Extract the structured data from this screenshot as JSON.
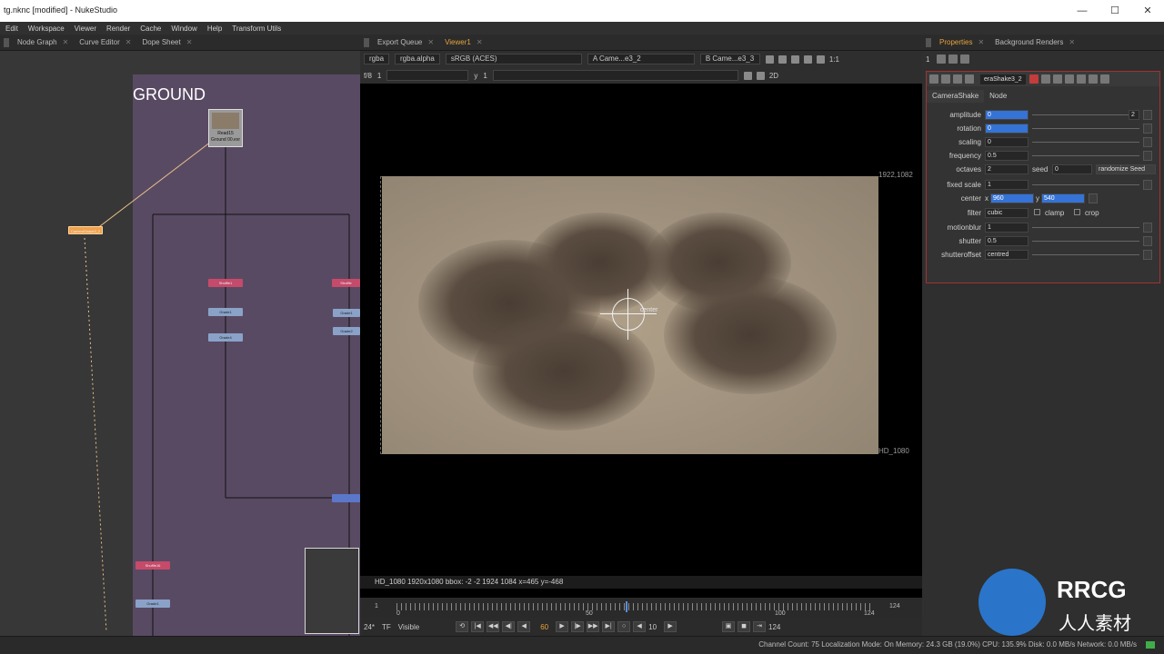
{
  "window": {
    "title": "tg.nknc [modified] - NukeStudio",
    "controls": [
      "—",
      "☐",
      "✕"
    ]
  },
  "menu": [
    "Edit",
    "Workspace",
    "Viewer",
    "Render",
    "Cache",
    "Window",
    "Help",
    "Transform Utils"
  ],
  "left_panel": {
    "tabs": [
      {
        "label": "Node Graph",
        "active": false
      },
      {
        "label": "Curve Editor",
        "active": false
      },
      {
        "label": "Dope Sheet",
        "active": false
      }
    ],
    "backdrop_label": "GROUND",
    "read_node": {
      "line1": "Read15",
      "line2": "Ground 00.exr"
    },
    "nodes": {
      "shuffle_a": "Shuffle1",
      "shuffle_b": "Shuffle",
      "shuffle_c": "Shuffle16",
      "grade_a": "Grade1",
      "grade_b": "Grade4",
      "grade_c": "Grade1",
      "grade_d": "Grade2",
      "grade_e": "Grade1",
      "camshake": "CameraShake3_2"
    }
  },
  "viewer": {
    "tabs": [
      {
        "label": "Export Queue",
        "active": false
      },
      {
        "label": "Viewer1",
        "active": true
      }
    ],
    "toolbar1": {
      "channels": "rgba",
      "alpha": "rgba.alpha",
      "colorspace": "sRGB (ACES)",
      "input_a": "A  Came...e3_2",
      "input_b": "B  Came...e3_3",
      "zoom": "1:1"
    },
    "toolbar2": {
      "fstop": "f/8",
      "frame_label": "1",
      "y_label": "y",
      "y_value": "1",
      "view_mode": "2D"
    },
    "format_corner": "1922,1082",
    "format_label": "HD_1080",
    "crosshair_label": "center",
    "info_line": "HD_1080 1920x1080  bbox: -2 -2 1924 1084  x=465 y=-468",
    "timeline": {
      "start": "1",
      "marks": [
        "0",
        "50",
        "100",
        "124"
      ],
      "end": "124",
      "current": "60"
    },
    "transport": {
      "fps": "24*",
      "tf": "TF",
      "visible": "Visible",
      "step": "10",
      "out_frame": "124"
    }
  },
  "properties": {
    "tabs": [
      {
        "label": "Properties",
        "active": true
      },
      {
        "label": "Background Renders",
        "active": false
      }
    ],
    "count": "1",
    "node_name": "eraShake3_2",
    "node_tabs": [
      "CameraShake",
      "Node"
    ],
    "rows": [
      {
        "label": "amplitude",
        "value": "0",
        "highlight": true
      },
      {
        "label": "rotation",
        "value": "0",
        "highlight": true
      },
      {
        "label": "scaling",
        "value": "0",
        "highlight": false
      },
      {
        "label": "frequency",
        "value": "0.5",
        "highlight": false
      },
      {
        "label": "octaves",
        "value": "2",
        "highlight": false
      },
      {
        "label": "fixed scale",
        "value": "1",
        "highlight": false
      },
      {
        "label": "center",
        "value": "960",
        "highlight": true
      },
      {
        "label": "filter",
        "value": "cubic",
        "highlight": false
      },
      {
        "label": "motionblur",
        "value": "1",
        "highlight": false
      },
      {
        "label": "shutter",
        "value": "0.5",
        "highlight": false
      },
      {
        "label": "shutteroffset",
        "value": "centred",
        "highlight": false
      }
    ],
    "amplitude_extra": "2",
    "seed_label": "seed",
    "seed_value": "0",
    "randomize_label": "randomize Seed",
    "center_x_label": "x",
    "center_y_label": "y",
    "center_y_value": "540",
    "clamp_label": "clamp",
    "crop_label": "crop"
  },
  "statusbar": {
    "text": "Channel Count: 75  Localization Mode: On  Memory: 24.3 GB (19.0%)  CPU: 135.9%  Disk: 0.0 MB/s  Network: 0.0 MB/s"
  },
  "watermark": {
    "brand": "RRCG",
    "sub": "人人素材"
  }
}
